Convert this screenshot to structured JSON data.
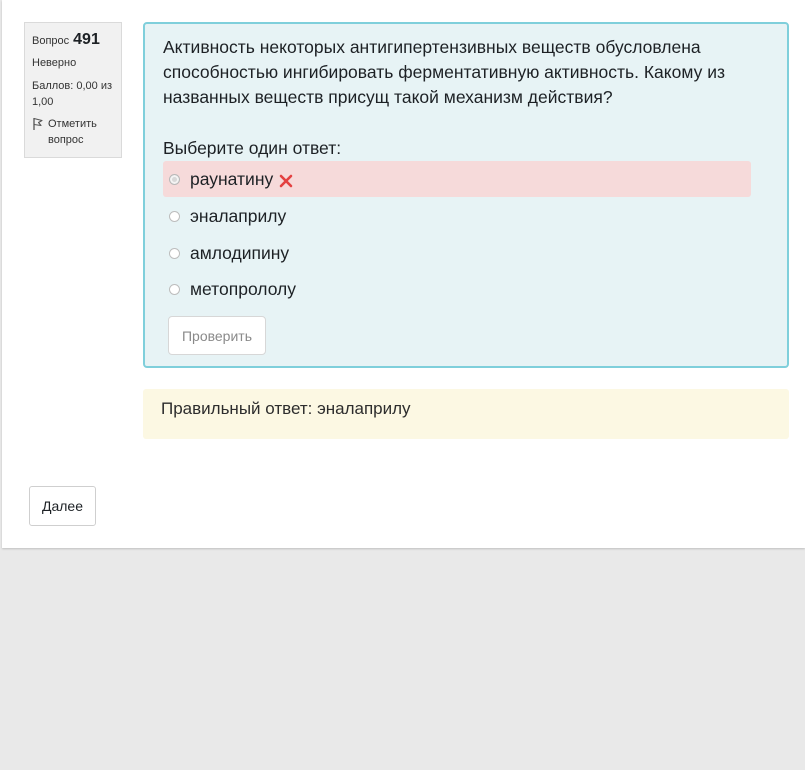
{
  "question_info": {
    "label": "Вопрос",
    "number": "491",
    "state": "Неверно",
    "grade": "Баллов: 0,00 из 1,00",
    "flag_label": "Отметить вопрос"
  },
  "question": {
    "text": "Активность некоторых антигипертензивных веществ обусловлена способностью ингибировать ферментативную активность. Какому из названных веществ присущ такой механизм действия?",
    "prompt": "Выберите один ответ:",
    "options": [
      {
        "label": "раунатину",
        "selected": true,
        "incorrect": true
      },
      {
        "label": "эналаприлу",
        "selected": false
      },
      {
        "label": "амлодипину",
        "selected": false
      },
      {
        "label": "метопрололу",
        "selected": false
      }
    ],
    "check_button": "Проверить"
  },
  "feedback": {
    "right_answer": "Правильный ответ: эналаприлу"
  },
  "navigation": {
    "next_button": "Далее"
  },
  "colors": {
    "incorrect_bg": "#f6dada",
    "formulation_bg": "#e7f3f5",
    "formulation_border": "#7fcfdb",
    "feedback_bg": "#fcf8e3",
    "incorrect_mark": "#e34141"
  },
  "icons": {
    "flag": "flag-icon",
    "incorrect": "cross-icon"
  }
}
